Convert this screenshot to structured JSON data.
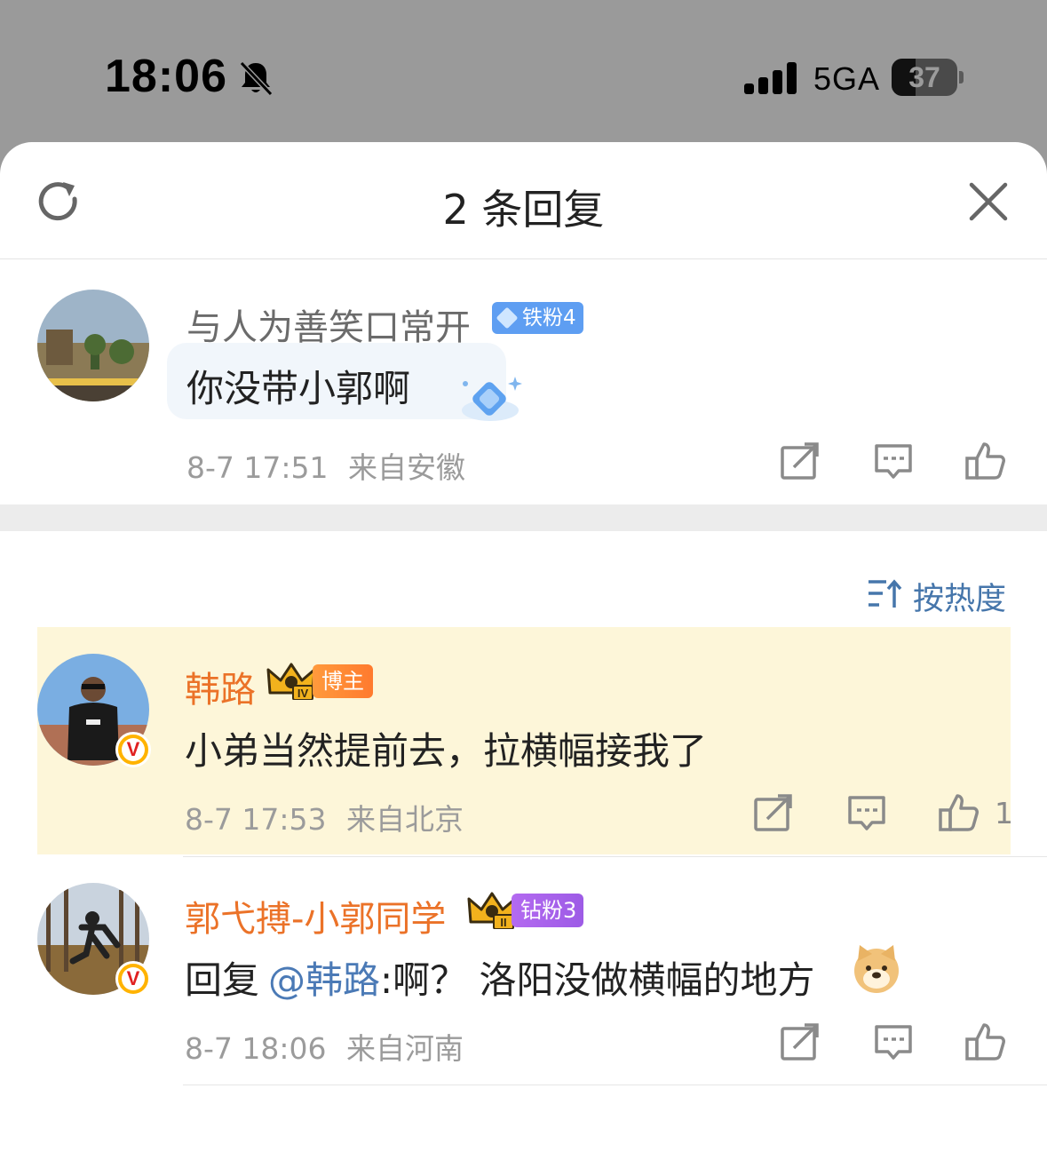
{
  "status_bar": {
    "time": "18:06",
    "network": "5GA",
    "battery": "37",
    "battery_level": 0.37
  },
  "header": {
    "title": "2 条回复",
    "icons": {
      "left": "refresh-icon",
      "right": "close-icon"
    }
  },
  "root_comment": {
    "username": "与人为善笑口常开",
    "fan_badge": "铁粉4",
    "text": "你没带小郭啊",
    "time": "8-7 17:51",
    "location": "来自安徽"
  },
  "sort": {
    "label": "按热度"
  },
  "replies": [
    {
      "username": "韩路",
      "tag": "博主",
      "crown_level": "IV",
      "text": "小弟当然提前去，拉横幅接我了",
      "time": "8-7 17:53",
      "location": "来自北京",
      "likes": "1",
      "highlighted": true
    },
    {
      "username": "郭弋搏-小郭同学",
      "tag": "钻粉3",
      "crown_level": "II",
      "reply_prefix": "回复",
      "mention": "@韩路",
      "text": ":啊？ 洛阳没做横幅的地方",
      "time": "8-7 18:06",
      "location": "来自河南",
      "likes": ""
    }
  ],
  "colors": {
    "accent_orange": "#eb7228",
    "link_blue": "#4b7ab6",
    "highlight_bg": "#fdf6d9"
  }
}
